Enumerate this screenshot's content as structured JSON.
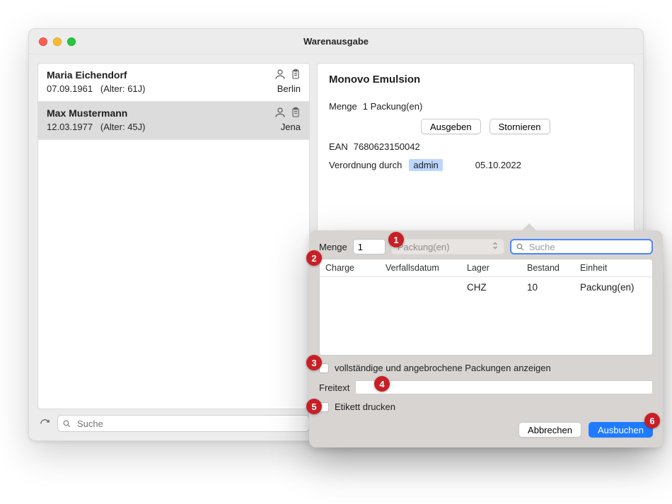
{
  "window": {
    "title": "Warenausgabe"
  },
  "patients": [
    {
      "name": "Maria Eichendorf",
      "dob": "07.09.1961",
      "age": "(Alter: 61J)",
      "city": "Berlin",
      "selected": false
    },
    {
      "name": "Max Mustermann",
      "dob": "12.03.1977",
      "age": "(Alter: 45J)",
      "city": "Jena",
      "selected": true
    }
  ],
  "left_search": {
    "placeholder": "Suche"
  },
  "product": {
    "name": "Monovo Emulsion",
    "menge_label": "Menge",
    "menge_value": "1 Packung(en)",
    "btn_ausgeben": "Ausgeben",
    "btn_stornieren": "Stornieren",
    "ean_label": "EAN",
    "ean_value": "7680623150042",
    "verordnung_label": "Verordnung durch",
    "verordnung_by": "admin",
    "verordnung_date": "05.10.2022"
  },
  "popover": {
    "menge_label": "Menge",
    "menge_value": "1",
    "unit_placeholder": "Packung(en)",
    "search_placeholder": "Suche",
    "columns": {
      "charge": "Charge",
      "exp": "Verfallsdatum",
      "lager": "Lager",
      "bestand": "Bestand",
      "einheit": "Einheit"
    },
    "rows": [
      {
        "charge": "",
        "exp": "",
        "lager": "CHZ",
        "bestand": "10",
        "einheit": "Packung(en)"
      }
    ],
    "check_full": "vollständige und angebrochene Packungen anzeigen",
    "freitext_label": "Freitext",
    "check_etikett": "Etikett drucken",
    "btn_cancel": "Abbrechen",
    "btn_confirm": "Ausbuchen"
  },
  "annotations": {
    "1": "1",
    "2": "2",
    "3": "3",
    "4": "4",
    "5": "5",
    "6": "6"
  }
}
